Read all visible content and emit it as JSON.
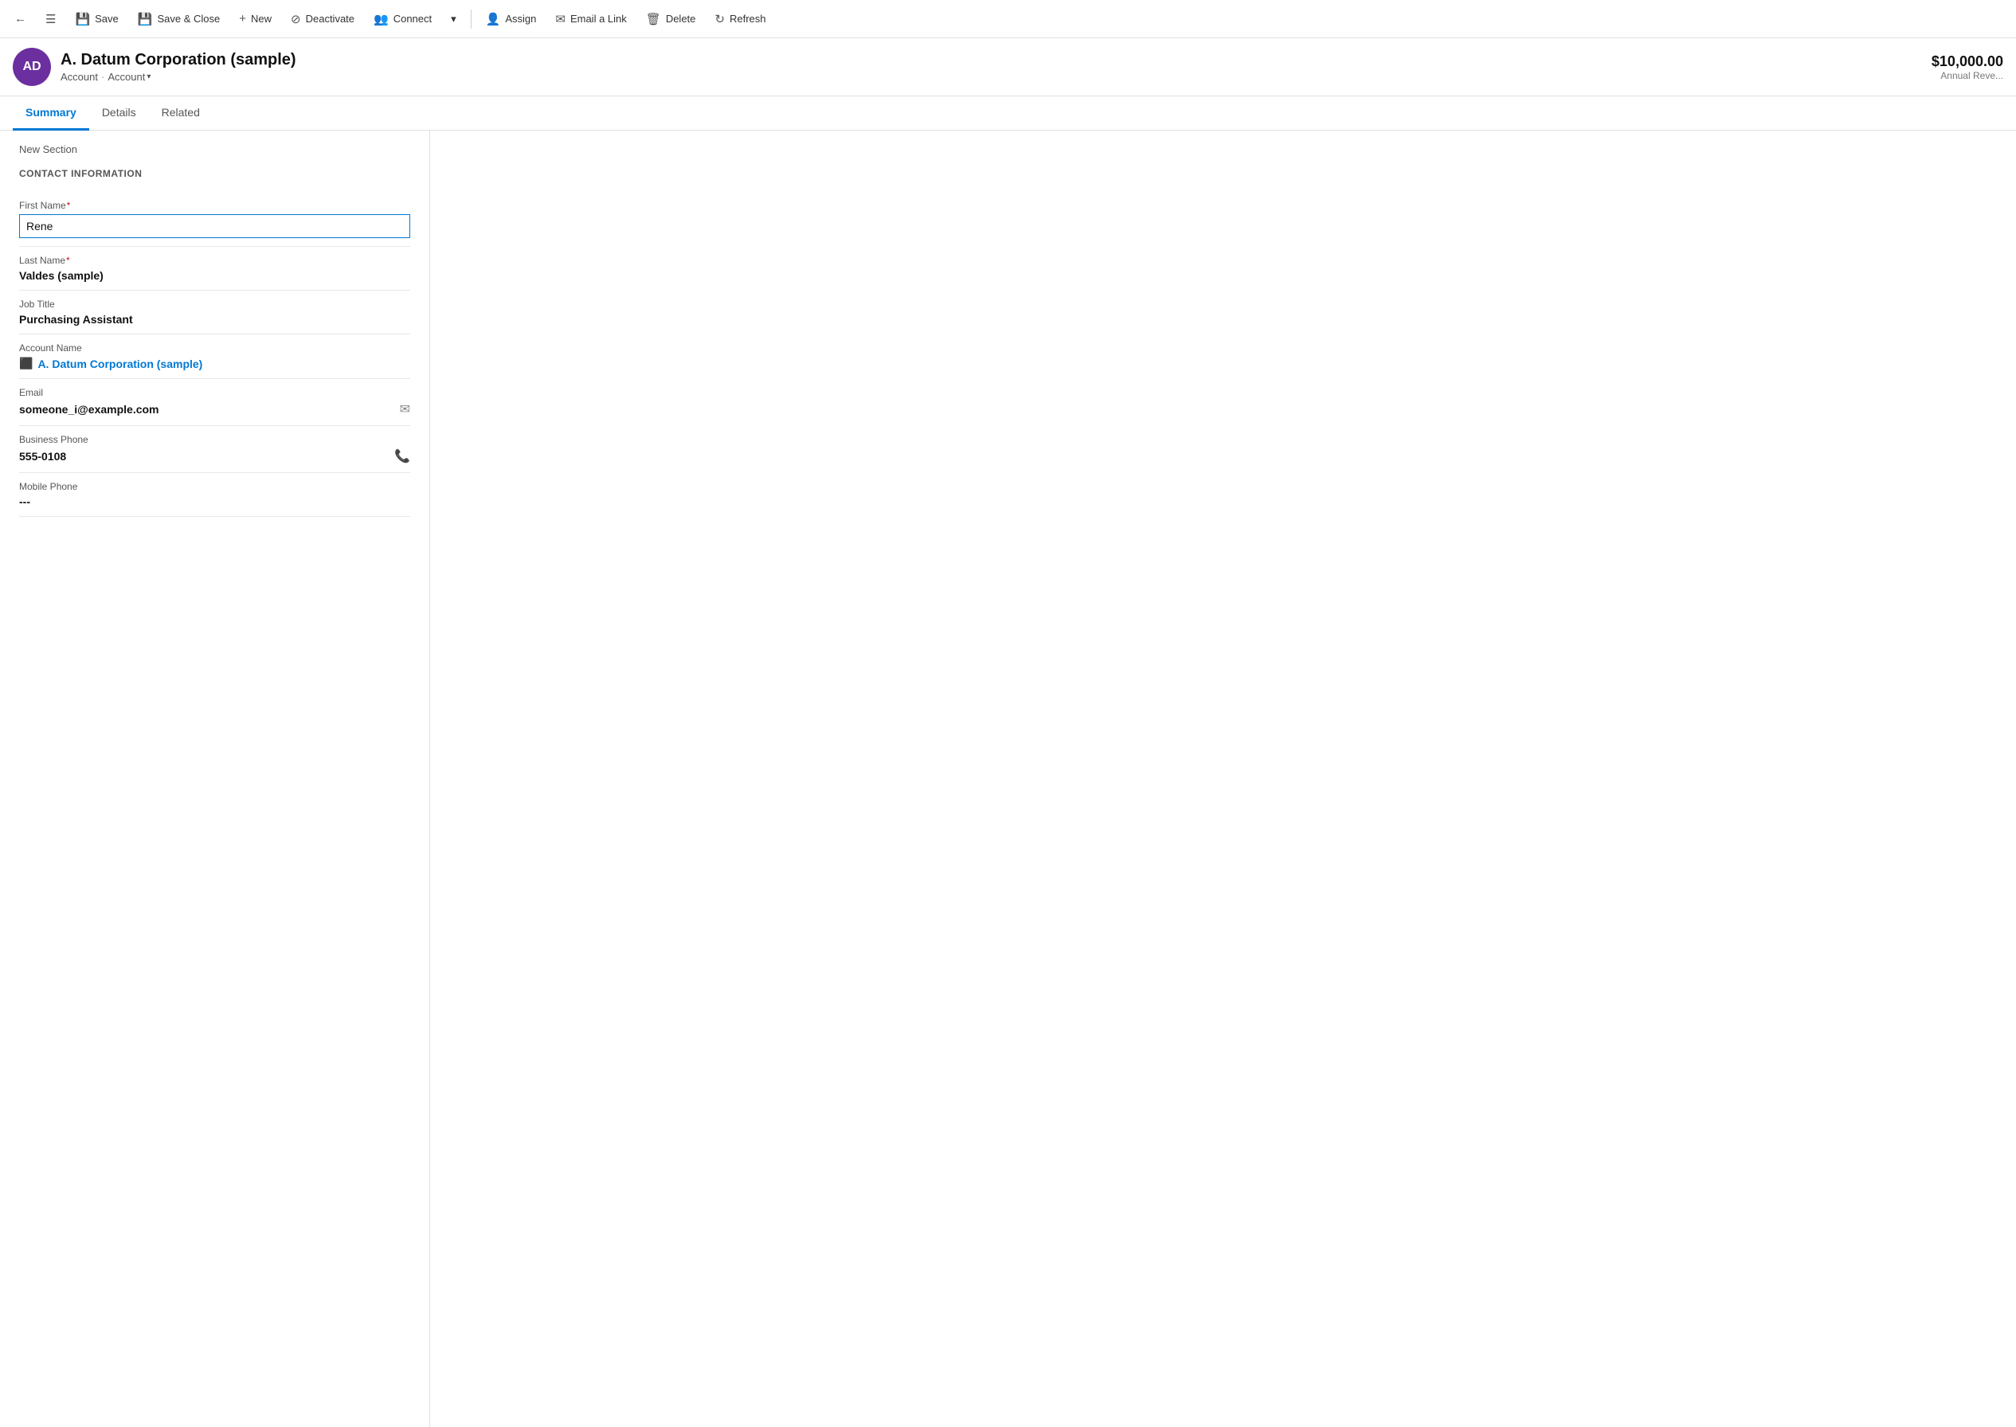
{
  "toolbar": {
    "back_icon": "←",
    "sidebar_icon": "☰",
    "save_label": "Save",
    "save_close_label": "Save & Close",
    "new_label": "New",
    "deactivate_label": "Deactivate",
    "connect_label": "Connect",
    "more_label": "▾",
    "assign_label": "Assign",
    "email_link_label": "Email a Link",
    "delete_label": "Delete",
    "refresh_label": "Refresh"
  },
  "record": {
    "avatar_text": "AD",
    "title": "A. Datum Corporation (sample)",
    "entity1": "Account",
    "entity2": "Account",
    "annual_revenue": "$10,000.00",
    "annual_revenue_label": "Annual Reve..."
  },
  "tabs": [
    {
      "id": "summary",
      "label": "Summary",
      "active": true
    },
    {
      "id": "details",
      "label": "Details",
      "active": false
    },
    {
      "id": "related",
      "label": "Related",
      "active": false
    }
  ],
  "form": {
    "new_section_label": "New Section",
    "contact_info_label": "CONTACT INFORMATION",
    "fields": [
      {
        "id": "first_name",
        "label": "First Name",
        "required": true,
        "value": "Rene",
        "type": "input"
      },
      {
        "id": "last_name",
        "label": "Last Name",
        "required": true,
        "value": "Valdes (sample)",
        "type": "text"
      },
      {
        "id": "job_title",
        "label": "Job Title",
        "required": false,
        "value": "Purchasing Assistant",
        "type": "text"
      },
      {
        "id": "account_name",
        "label": "Account Name",
        "required": false,
        "value": "A. Datum Corporation (sample)",
        "type": "link"
      },
      {
        "id": "email",
        "label": "Email",
        "required": false,
        "value": "someone_i@example.com",
        "type": "email"
      },
      {
        "id": "business_phone",
        "label": "Business Phone",
        "required": false,
        "value": "555-0108",
        "type": "phone"
      },
      {
        "id": "mobile_phone",
        "label": "Mobile Phone",
        "required": false,
        "value": "---",
        "type": "text"
      }
    ]
  },
  "icons": {
    "save": "💾",
    "save_close": "💾",
    "new": "+",
    "deactivate": "🚫",
    "connect": "👥",
    "assign": "👤",
    "email_link": "✉",
    "delete": "🗑",
    "refresh": "↻",
    "account_entity": "🔲",
    "email_action": "✉",
    "phone_action": "📞"
  }
}
